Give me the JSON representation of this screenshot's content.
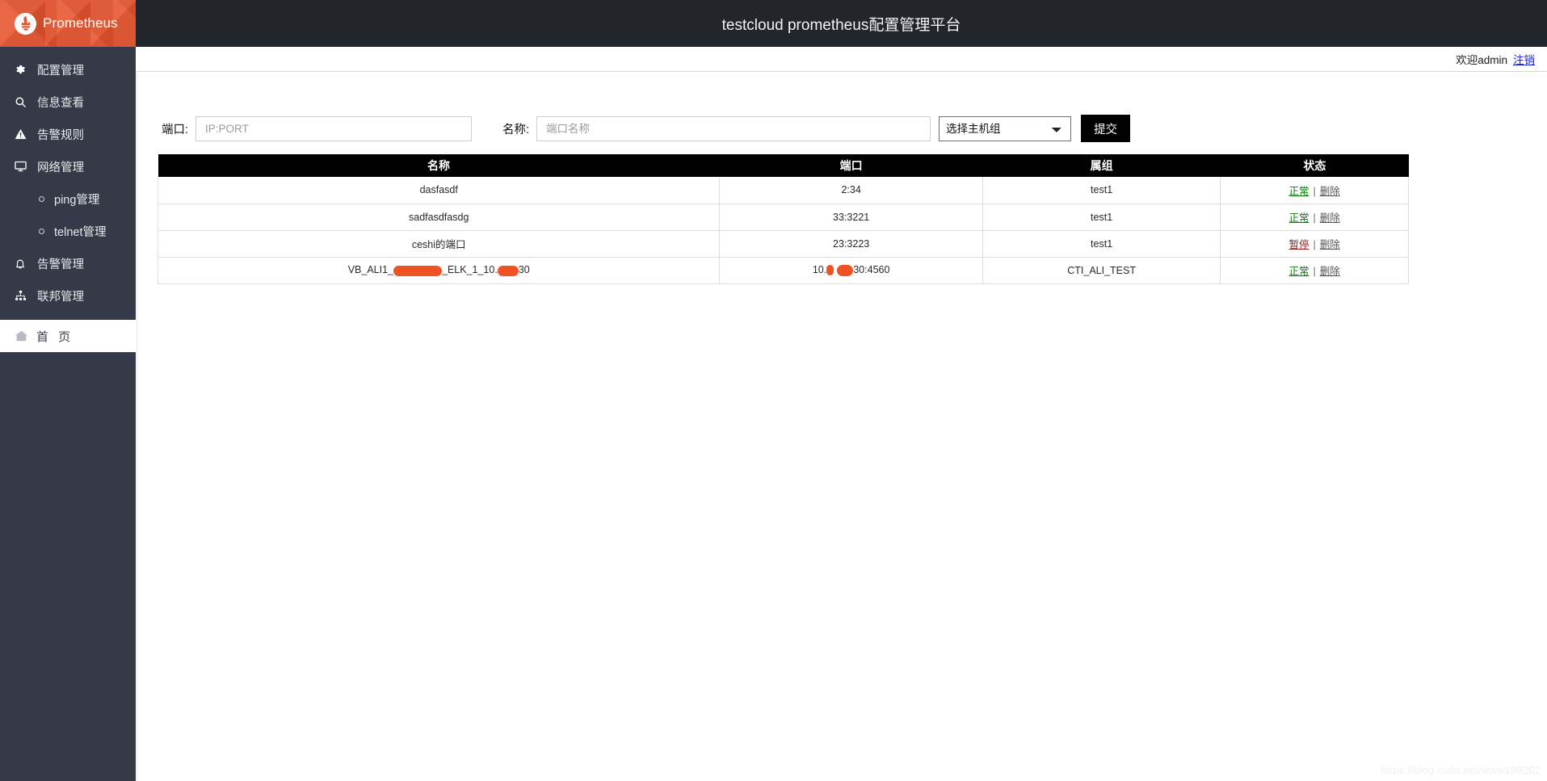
{
  "brand": {
    "name": "Prometheus",
    "logo_icon": "prometheus-logo-icon"
  },
  "sidebar": {
    "items": [
      {
        "label": "配置管理",
        "icon": "gear-icon"
      },
      {
        "label": "信息查看",
        "icon": "search-icon"
      },
      {
        "label": "告警规则",
        "icon": "warning-triangle-icon"
      },
      {
        "label": "网络管理",
        "icon": "monitor-icon"
      }
    ],
    "subitems": [
      {
        "label": "ping管理",
        "icon": "circle-bullet-icon"
      },
      {
        "label": "telnet管理",
        "icon": "circle-bullet-icon"
      }
    ],
    "items2": [
      {
        "label": "告警管理",
        "icon": "bell-icon"
      },
      {
        "label": "联邦管理",
        "icon": "sitemap-icon"
      }
    ],
    "home": {
      "label": "首 页",
      "icon": "home-icon"
    }
  },
  "header": {
    "title": "testcloud prometheus配置管理平台",
    "welcome": "欢迎admin",
    "logout": "注销"
  },
  "filter": {
    "port_label": "端口:",
    "port_placeholder": "IP:PORT",
    "port_value": "",
    "name_label": "名称:",
    "name_placeholder": "端口名称",
    "name_value": "",
    "group_selected": "选择主机组",
    "group_options": [
      "选择主机组"
    ],
    "submit_label": "提交"
  },
  "table": {
    "columns": [
      "名称",
      "端口",
      "属组",
      "状态"
    ],
    "rows": [
      {
        "name": "dasfasdf",
        "name_redacted": false,
        "port": "2:34",
        "port_redacted": false,
        "group": "test1",
        "status": "正常",
        "status_type": "ok",
        "delete": "删除"
      },
      {
        "name": "sadfasdfasdg",
        "name_redacted": false,
        "port": "33:3221",
        "port_redacted": false,
        "group": "test1",
        "status": "正常",
        "status_type": "ok",
        "delete": "删除"
      },
      {
        "name": "ceshi的端口",
        "name_redacted": false,
        "port": "23:3223",
        "port_redacted": false,
        "group": "test1",
        "status": "暂停",
        "status_type": "pause",
        "delete": "删除"
      },
      {
        "name_prefix": "VB_ALI1_",
        "name_mid": "_ELK_1_10.",
        "name_suffix": "30",
        "name_redacted": true,
        "port_prefix": "10.",
        "port_suffix": "30:4560",
        "port_redacted": true,
        "group": "CTI_ALI_TEST",
        "status": "正常",
        "status_type": "ok",
        "delete": "删除"
      }
    ],
    "status_colors": {
      "ok": "#107a10",
      "pause": "#9b1b1b",
      "delete": "#555555"
    }
  },
  "watermark": {
    "text": "https://blog.csdn.net/www199202"
  },
  "colors": {
    "brand": "#e6522c",
    "sidebar": "#343a48",
    "topbar": "#22252c",
    "link": "#1a27e0"
  }
}
